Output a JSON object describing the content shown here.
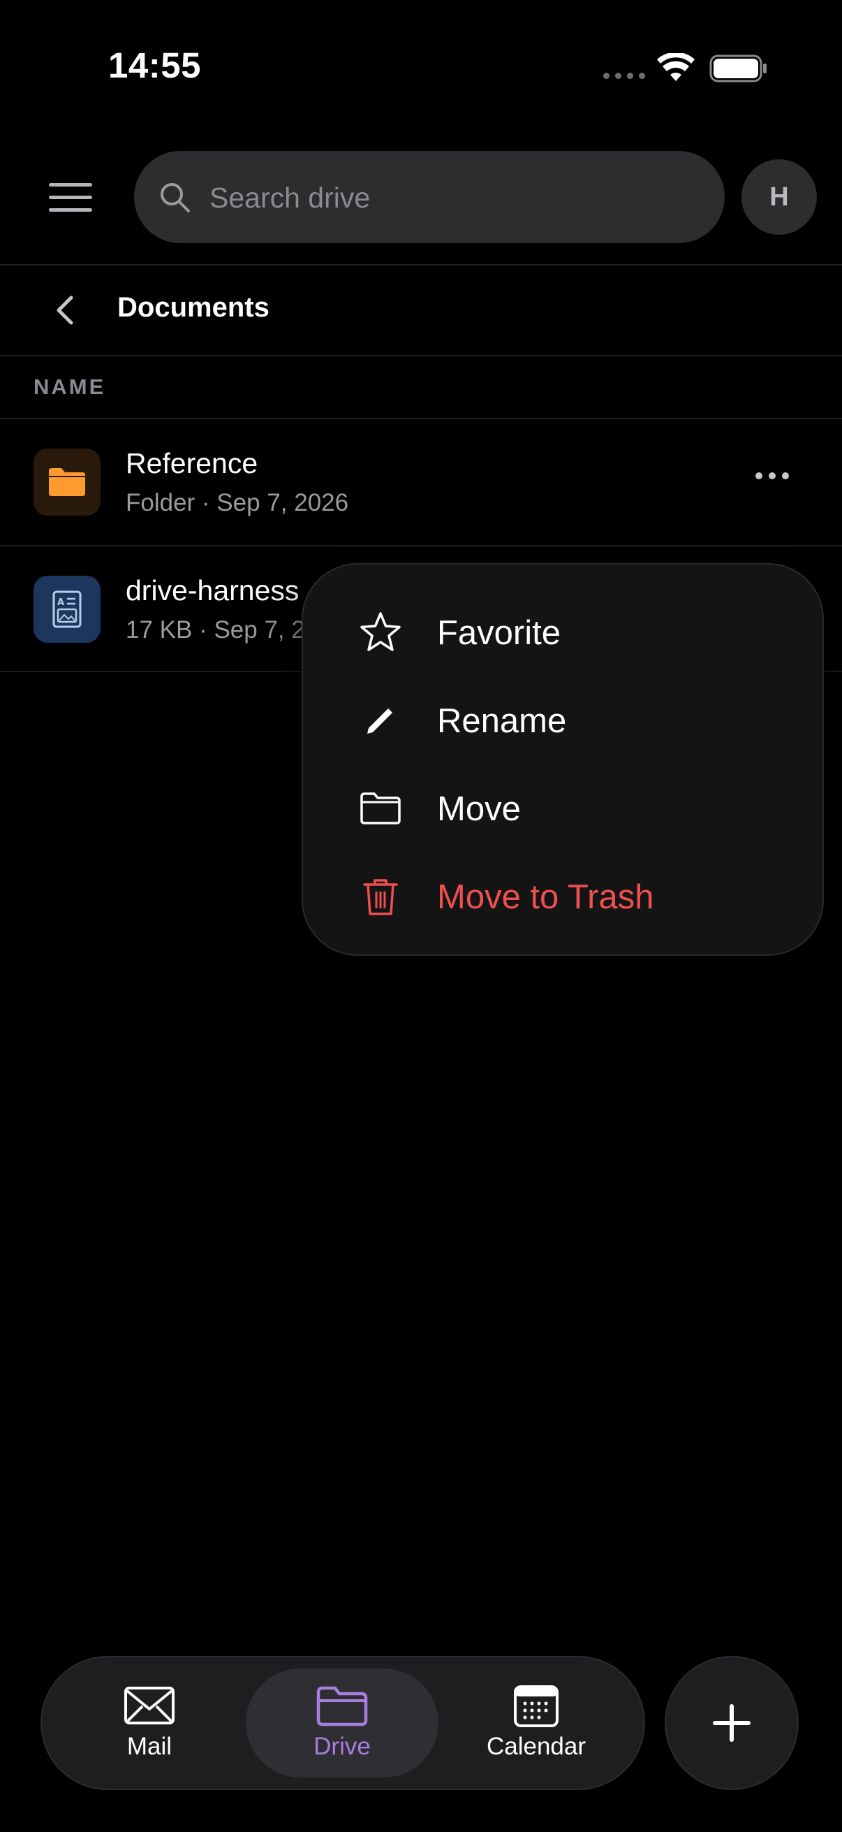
{
  "status_bar": {
    "time": "14:55"
  },
  "header": {
    "search": {
      "placeholder": "Search drive"
    },
    "avatar_initial": "H"
  },
  "breadcrumb": {
    "title": "Documents"
  },
  "list": {
    "column_header": "NAME",
    "items": [
      {
        "name": "Reference",
        "meta": "Folder · Sep 7, 2026",
        "icon": "folder-icon"
      },
      {
        "name": "drive-harness",
        "meta": "17 KB · Sep 7, 2",
        "icon": "document-icon"
      }
    ]
  },
  "context_menu": {
    "items": [
      {
        "label": "Favorite",
        "icon": "star-icon"
      },
      {
        "label": "Rename",
        "icon": "pencil-icon"
      },
      {
        "label": "Move",
        "icon": "folder-outline-icon"
      },
      {
        "label": "Move to Trash",
        "icon": "trash-icon",
        "color": "#ef4f4f"
      }
    ]
  },
  "tab_bar": {
    "tabs": [
      {
        "label": "Mail",
        "icon": "envelope-icon"
      },
      {
        "label": "Drive",
        "icon": "folder-icon",
        "active": true,
        "color": "#a87de0"
      },
      {
        "label": "Calendar",
        "icon": "calendar-icon"
      }
    ],
    "fab_icon": "plus-icon"
  },
  "colors": {
    "background": "#000000",
    "accent_orange": "#ff9a2e",
    "accent_purple": "#a87de0",
    "danger": "#ef4f4f"
  }
}
